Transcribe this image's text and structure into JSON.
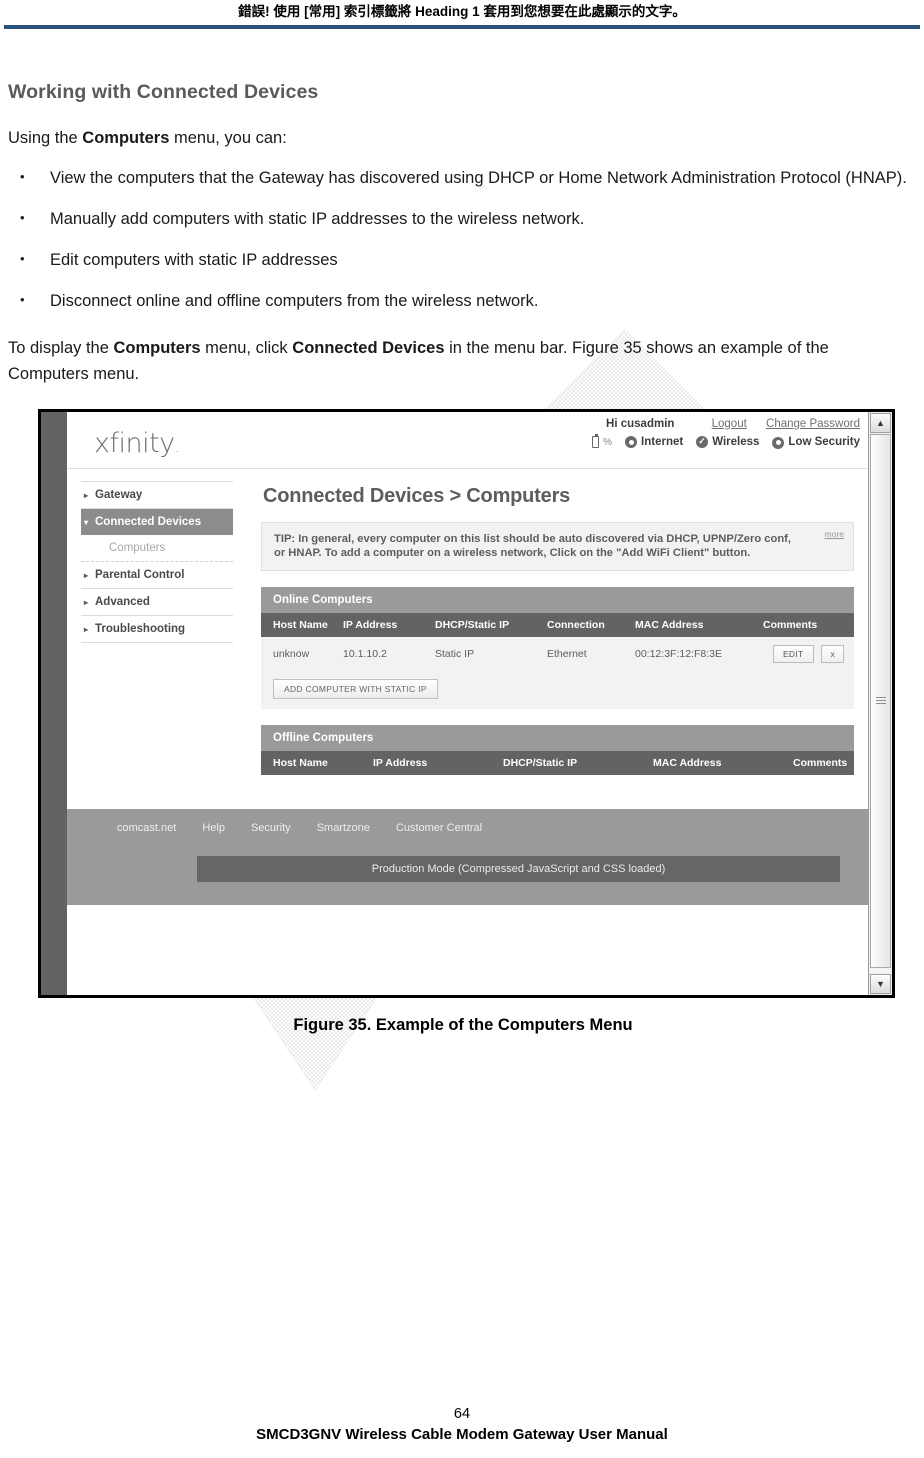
{
  "doc": {
    "header_note": "錯誤! 使用 [常用] 索引標籤將 Heading 1 套用到您想要在此處顯示的文字。",
    "section_title": "Working with Connected Devices",
    "intro_prefix": "Using the ",
    "intro_bold": "Computers",
    "intro_suffix": " menu, you can:",
    "bullets": [
      "View the computers that the Gateway has discovered using DHCP or Home Network Administration Protocol (HNAP).",
      "Manually add computers with static IP addresses to the wireless network.",
      "Edit computers with static IP addresses",
      "Disconnect online and offline computers from the wireless network."
    ],
    "lead_in_1": "To display the ",
    "lead_in_b1": "Computers",
    "lead_in_2": " menu, click ",
    "lead_in_b2": "Connected Devices",
    "lead_in_3": " in the menu bar. Figure 35 shows an example of the Computers menu.",
    "caption": "Figure 35. Example of the Computers Menu",
    "page_number": "64",
    "manual_title": "SMCD3GNV Wireless Cable Modem Gateway User Manual",
    "rule_color": "#2b527a"
  },
  "app": {
    "logo": "xfinity",
    "topbar": {
      "greeting": "Hi cusadmin",
      "logout": "Logout",
      "change_password": "Change Password",
      "battery_icon": "battery-icon",
      "battery_percent": "%",
      "status": [
        {
          "icon": "internet-status-icon",
          "label": "Internet",
          "style": "dot"
        },
        {
          "icon": "wireless-status-icon",
          "label": "Wireless",
          "style": "check"
        },
        {
          "icon": "security-status-icon",
          "label": "Low Security",
          "style": "dot"
        }
      ]
    },
    "sidebar": {
      "items": [
        {
          "label": "Gateway",
          "caret": "▸",
          "active": false
        },
        {
          "label": "Connected Devices",
          "caret": "▾",
          "active": true
        }
      ],
      "sub_item": "Computers",
      "items_after": [
        {
          "label": "Parental Control",
          "caret": "▸"
        },
        {
          "label": "Advanced",
          "caret": "▸"
        },
        {
          "label": "Troubleshooting",
          "caret": "▸"
        }
      ]
    },
    "page_title": "Connected Devices > Computers",
    "tip": {
      "text": "TIP: In general, every computer on this list should be auto discovered via DHCP, UPNP/Zero conf, or HNAP. To add a computer on a wireless network, Click on the \"Add WiFi Client\" button.",
      "more_label": "more"
    },
    "online_panel": {
      "title": "Online Computers",
      "columns": [
        "Host Name",
        "IP Address",
        "DHCP/Static IP",
        "Connection",
        "MAC Address",
        "Comments",
        ""
      ],
      "rows": [
        {
          "host_name": "unknow",
          "ip_address": "10.1.10.2",
          "dhcp_static": "Static IP",
          "connection": "Ethernet",
          "mac_address": "00:12:3F:12:F8:3E",
          "comments": "",
          "edit_label": "EDIT",
          "delete_label": "x"
        }
      ],
      "add_button": "ADD COMPUTER WITH STATIC IP"
    },
    "offline_panel": {
      "title": "Offline Computers",
      "columns": [
        "Host Name",
        "IP Address",
        "DHCP/Static IP",
        "MAC Address",
        "Comments"
      ],
      "rows": []
    },
    "footer": {
      "links": [
        "comcast.net",
        "Help",
        "Security",
        "Smartzone",
        "Customer Central"
      ],
      "production_mode": "Production Mode (Compressed JavaScript and CSS loaded)"
    },
    "scrollbar": {
      "up_arrow": "▲",
      "down_arrow": "▼"
    }
  }
}
